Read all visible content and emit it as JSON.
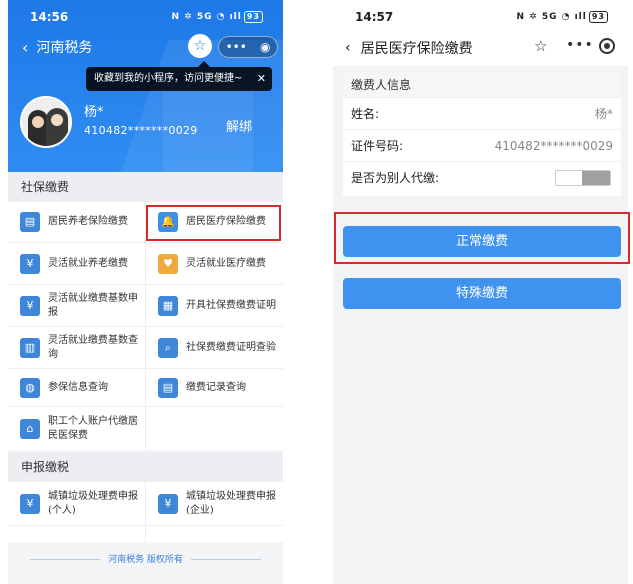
{
  "left": {
    "status": {
      "time": "14:56",
      "signal": "N ✲ 5G ◔ ıll",
      "battery": "93"
    },
    "nav": {
      "back": "‹",
      "title": "河南税务",
      "star": "☆",
      "dots": "•••",
      "record": "◉"
    },
    "tooltip": {
      "text": "收藏到我的小程序，访问更便捷~",
      "close": "✕"
    },
    "user": {
      "name": "杨*",
      "id": "410482*******0029",
      "unbind": "解绑"
    },
    "section1": "社保缴费",
    "section2": "申报缴税",
    "items": [
      {
        "label": "居民养老保险缴费",
        "color": "#3e86d8",
        "glyph": "▤"
      },
      {
        "label": "居民医疗保险缴费",
        "color": "#3f8ee8",
        "glyph": "🔔"
      },
      {
        "label": "灵活就业养老缴费",
        "color": "#3e86d8",
        "glyph": "¥"
      },
      {
        "label": "灵活就业医疗缴费",
        "color": "#f0a93a",
        "glyph": "♥"
      },
      {
        "label": "灵活就业缴费基数申报",
        "color": "#3e86d8",
        "glyph": "¥"
      },
      {
        "label": "开具社保费缴费证明",
        "color": "#3e86d8",
        "glyph": "▦"
      },
      {
        "label": "灵活就业缴费基数查询",
        "color": "#3e86d8",
        "glyph": "▥"
      },
      {
        "label": "社保费缴费证明查验",
        "color": "#3e86d8",
        "glyph": "⌕"
      },
      {
        "label": "参保信息查询",
        "color": "#3e86d8",
        "glyph": "◍"
      },
      {
        "label": "缴费记录查询",
        "color": "#3e86d8",
        "glyph": "▤"
      },
      {
        "label": "职工个人账户代缴居民医保费",
        "color": "#3e86d8",
        "glyph": "⌂"
      }
    ],
    "items2": [
      {
        "label": "城镇垃圾处理费申报(个人)",
        "color": "#3e86d8",
        "glyph": "¥"
      },
      {
        "label": "城镇垃圾处理费申报(企业)",
        "color": "#3e86d8",
        "glyph": "¥"
      }
    ],
    "footer": "河南税务 版权所有"
  },
  "right": {
    "status": {
      "time": "14:57",
      "signal": "N ✲ 5G ◔ ıll",
      "battery": "93"
    },
    "nav": {
      "back": "‹",
      "title": "居民医疗保险缴费",
      "star": "☆",
      "dots": "•••"
    },
    "card": {
      "header": "缴费人信息",
      "name_label": "姓名:",
      "name_value": "杨*",
      "id_label": "证件号码:",
      "id_value": "410482*******0029",
      "proxy_label": "是否为别人代缴:"
    },
    "btn_normal": "正常缴费",
    "btn_special": "特殊缴费"
  }
}
